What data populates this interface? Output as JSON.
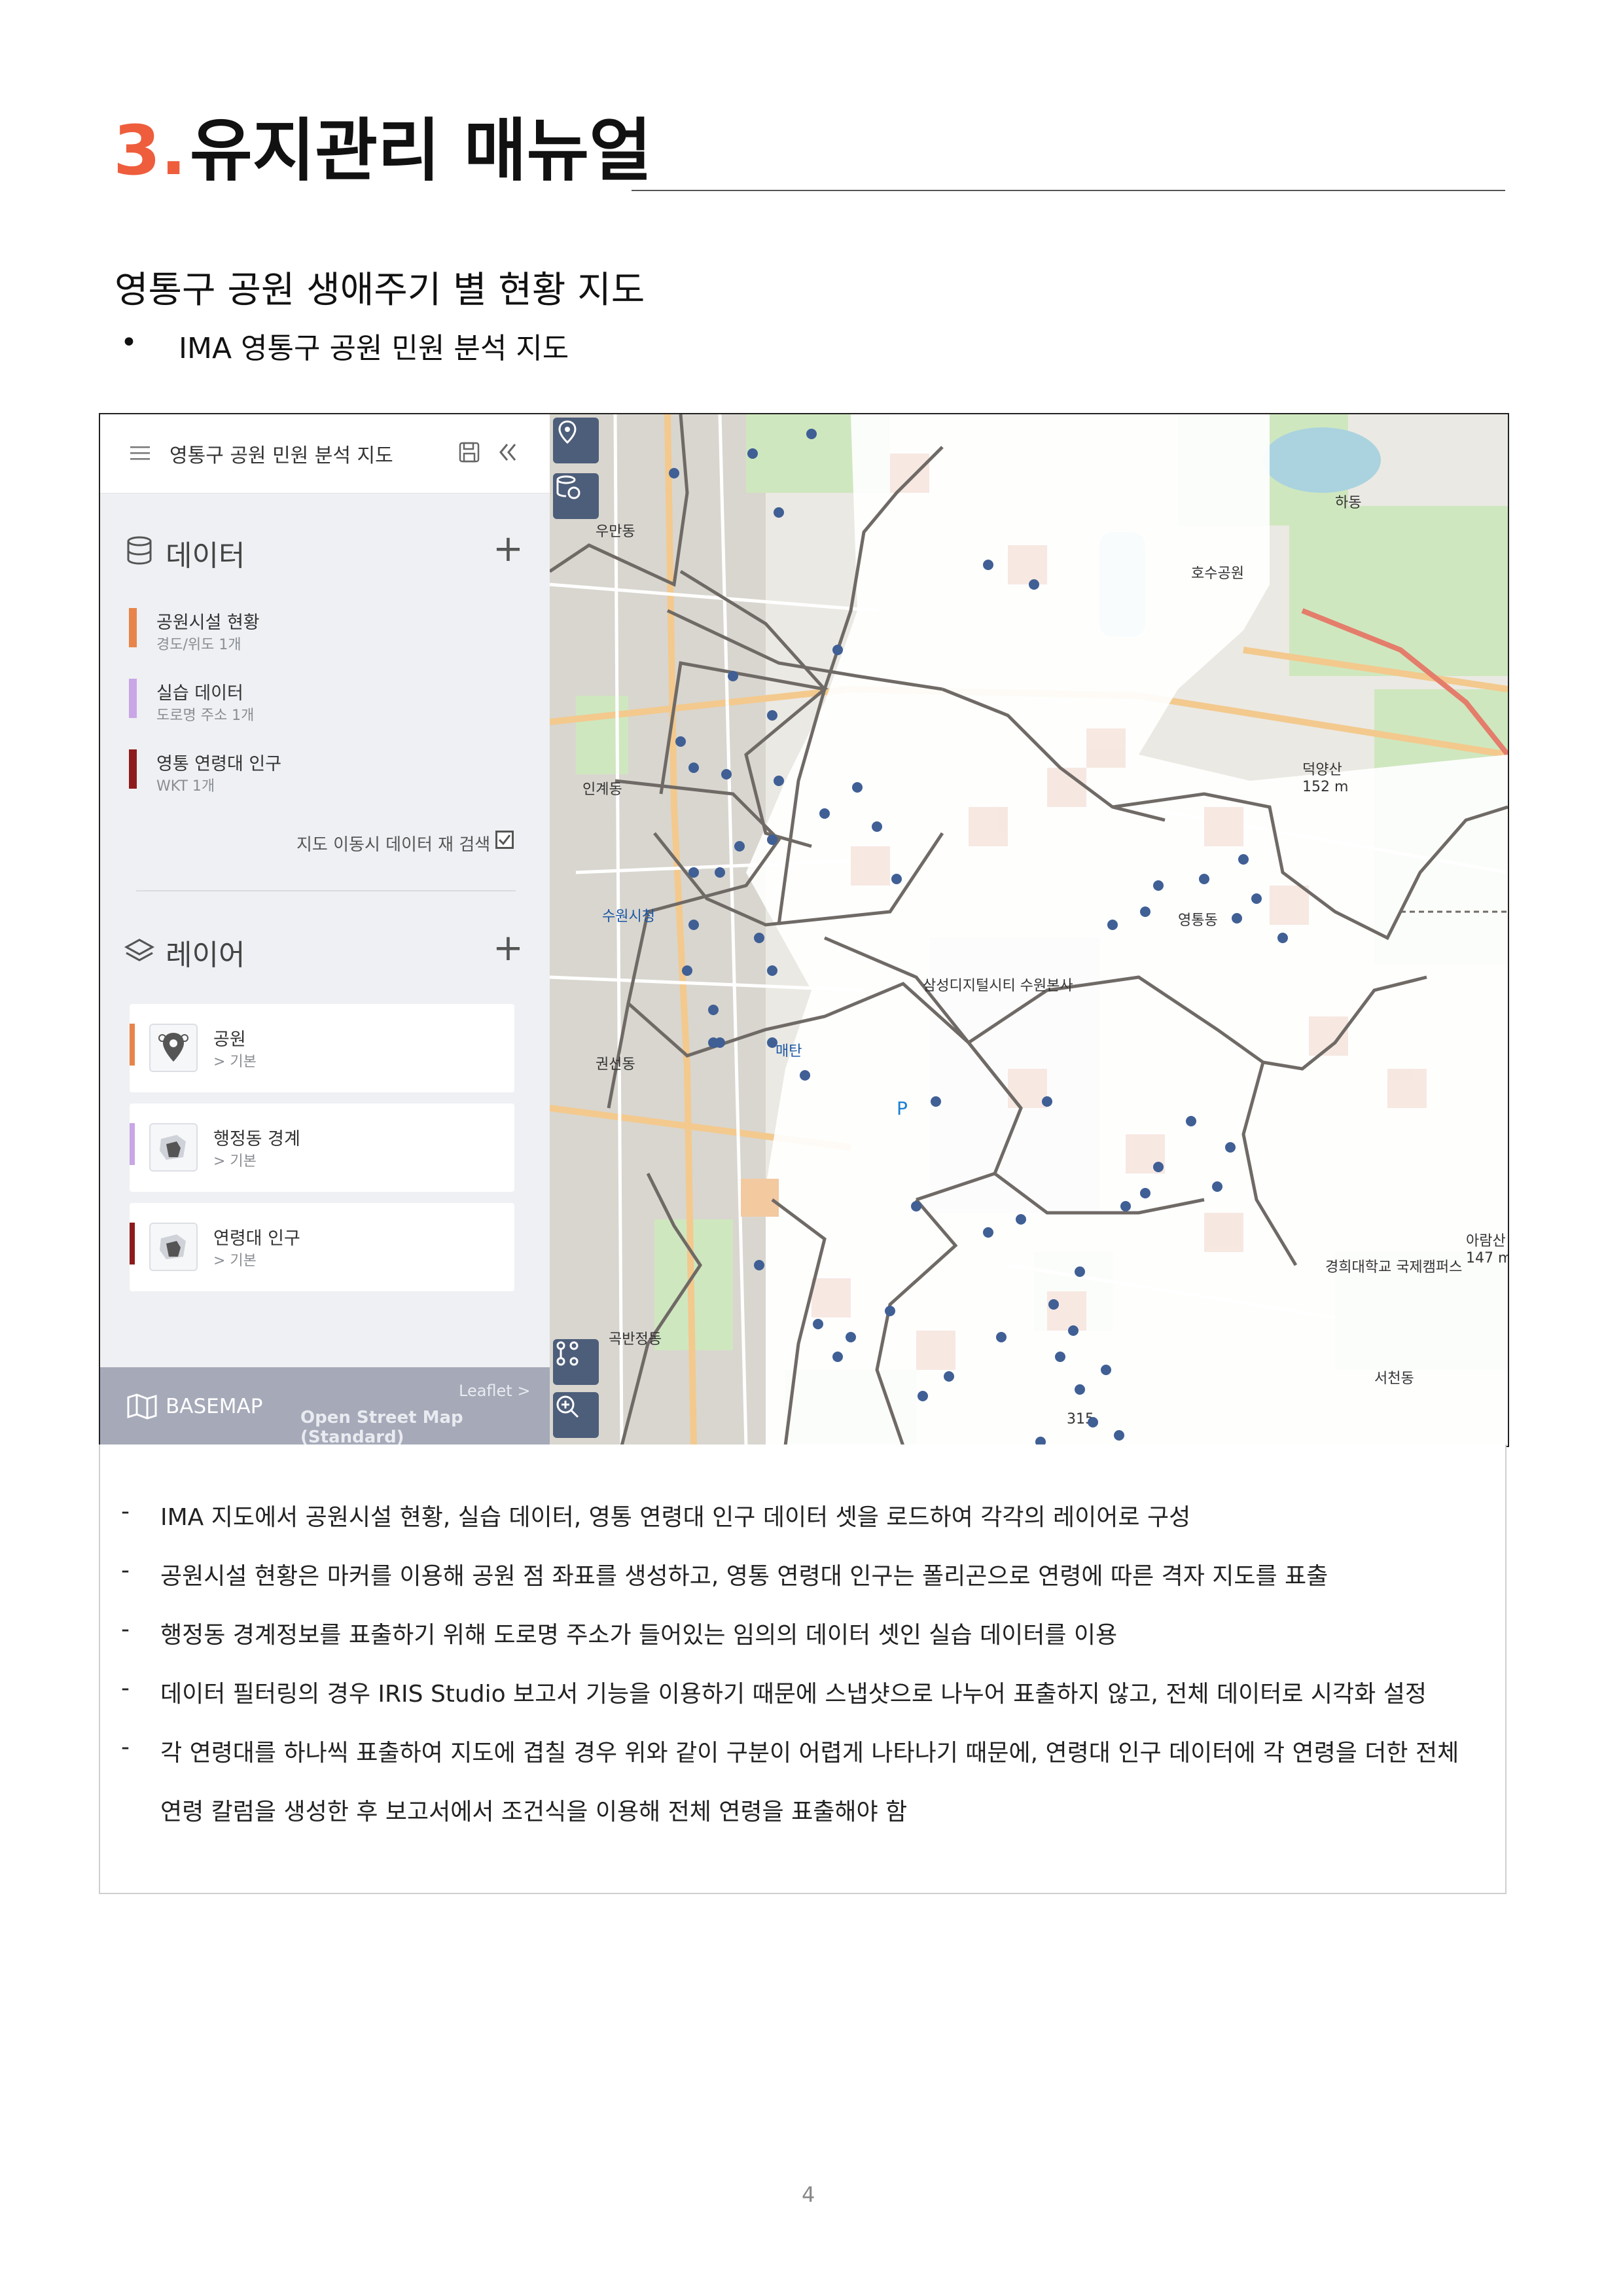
{
  "heading": {
    "number": "3.",
    "text": "유지관리 매뉴얼"
  },
  "subtitle": "영통구 공원 생애주기 별 현황 지도",
  "bullet": {
    "marker": "•",
    "text": "IMA 영통구 공원 민원 분석 지도"
  },
  "panel": {
    "title": "영통구 공원 민원 분석 지도",
    "data_section": {
      "title": "데이터",
      "add": "+"
    },
    "data_items": [
      {
        "name": "공원시설 현황",
        "sub": "경도/위도 1개",
        "color": "#e8844a"
      },
      {
        "name": "실습 데이터",
        "sub": "도로명 주소 1개",
        "color": "#c9a6e6"
      },
      {
        "name": "영통 연령대 인구",
        "sub": "WKT 1개",
        "color": "#8e1b1b"
      }
    ],
    "retry": {
      "label": "지도 이동시 데이터 재 검색",
      "checked": true
    },
    "layer_section": {
      "title": "레이어",
      "add": "+"
    },
    "layers": [
      {
        "name": "공원",
        "sub": "> 기본",
        "color": "#e8844a"
      },
      {
        "name": "행정동 경계",
        "sub": "> 기본",
        "color": "#c9a6e6"
      },
      {
        "name": "연령대 인구",
        "sub": "> 기본",
        "color": "#8e1b1b"
      }
    ],
    "basemap": {
      "label": "BASEMAP",
      "provider": "Leaflet >",
      "style": "Open Street Map (Standard)"
    }
  },
  "map": {
    "marker_color": "#3f5f95",
    "labels": [
      "우만동",
      "인계동",
      "수원시청",
      "권선동",
      "곡반정동",
      "영통동",
      "매탄",
      "삼성디지털시티 수원본사",
      "덕양산",
      "152 m",
      "호수공원",
      "하동",
      "경희대학교 국제캠퍼스",
      "서천동",
      "315",
      "P",
      "아람산",
      "147 m"
    ]
  },
  "description": [
    "IMA 지도에서 공원시설 현황, 실습 데이터, 영통 연령대 인구 데이터 셋을 로드하여 각각의 레이어로 구성",
    "공원시설 현황은 마커를 이용해 공원 점 좌표를 생성하고, 영통 연령대 인구는 폴리곤으로 연령에 따른 격자 지도를 표출",
    "행정동 경계정보를 표출하기 위해 도로명 주소가 들어있는 임의의 데이터 셋인 실습 데이터를 이용",
    "데이터 필터링의 경우 IRIS Studio 보고서 기능을 이용하기 때문에 스냅샷으로 나누어 표출하지 않고, 전체 데이터로 시각화 설정",
    "각 연령대를 하나씩 표출하여 지도에 겹칠 경우 위와 같이 구분이 어렵게 나타나기 때문에, 연령대 인구 데이터에 각 연령을 더한 전체"
  ],
  "description_continuation": "연령 칼럼을 생성한 후 보고서에서 조건식을 이용해 전체 연령을 표출해야 함",
  "dash": "-",
  "page_number": "4"
}
